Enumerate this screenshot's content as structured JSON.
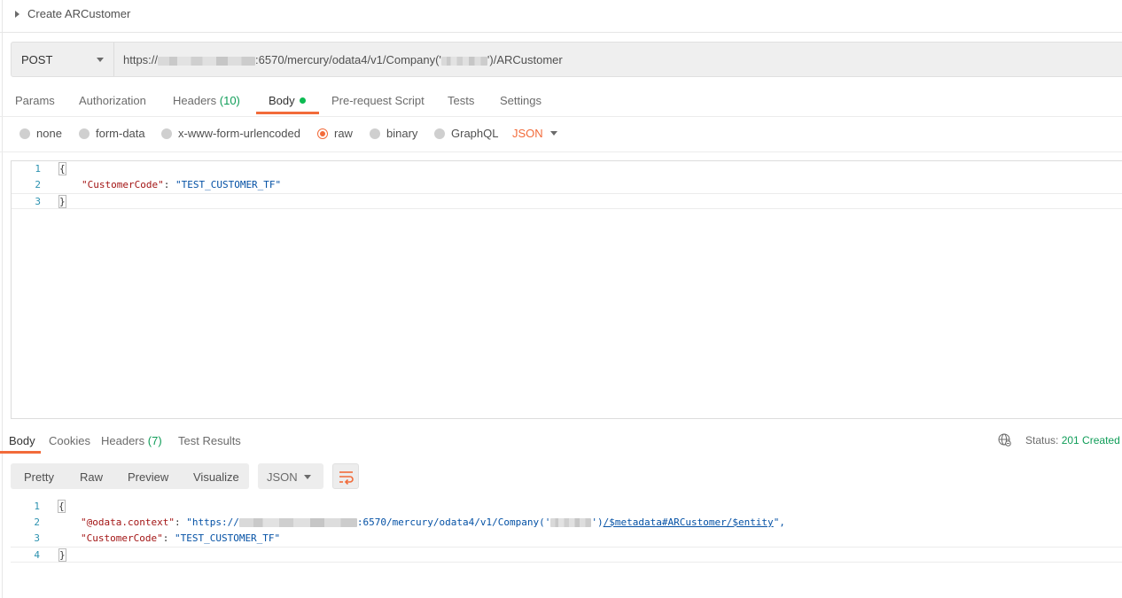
{
  "request": {
    "title": "Create ARCustomer",
    "method": "POST",
    "url_prefix": "https://",
    "url_middle": ":6570/mercury/odata4/v1/Company('",
    "url_suffix": "')/ARCustomer"
  },
  "request_tabs": [
    {
      "label": "Params"
    },
    {
      "label": "Authorization"
    },
    {
      "label": "Headers",
      "count": "(10)"
    },
    {
      "label": "Body"
    },
    {
      "label": "Pre-request Script"
    },
    {
      "label": "Tests"
    },
    {
      "label": "Settings"
    }
  ],
  "body_modes": [
    {
      "label": "none"
    },
    {
      "label": "form-data"
    },
    {
      "label": "x-www-form-urlencoded"
    },
    {
      "label": "raw"
    },
    {
      "label": "binary"
    },
    {
      "label": "GraphQL"
    }
  ],
  "body_format": "JSON",
  "request_body": {
    "lines": [
      "1",
      "2",
      "3"
    ],
    "open_brace": "{",
    "close_brace": "}",
    "key": "\"CustomerCode\"",
    "sep": ": ",
    "value": "\"TEST_CUSTOMER_TF\""
  },
  "response_tabs": [
    {
      "label": "Body"
    },
    {
      "label": "Cookies"
    },
    {
      "label": "Headers",
      "count": "(7)"
    },
    {
      "label": "Test Results"
    }
  ],
  "status": {
    "label": "Status:",
    "value": "201 Created"
  },
  "view_modes": [
    {
      "label": "Pretty"
    },
    {
      "label": "Raw"
    },
    {
      "label": "Preview"
    },
    {
      "label": "Visualize"
    }
  ],
  "response_format": "JSON",
  "response_body": {
    "lines": [
      "1",
      "2",
      "3",
      "4"
    ],
    "open_brace": "{",
    "close_brace": "}",
    "context_key": "\"@odata.context\"",
    "context_prefix": "\"https://",
    "context_middle": ":6570/mercury/odata4/v1/Company('",
    "context_close": "')",
    "context_link": "/$metadata#ARCustomer/$entity",
    "context_end": "\",",
    "key": "\"CustomerCode\"",
    "sep": ": ",
    "value": "\"TEST_CUSTOMER_TF\""
  },
  "colors": {
    "accent": "#f26b3a",
    "success": "#0f9d58"
  }
}
